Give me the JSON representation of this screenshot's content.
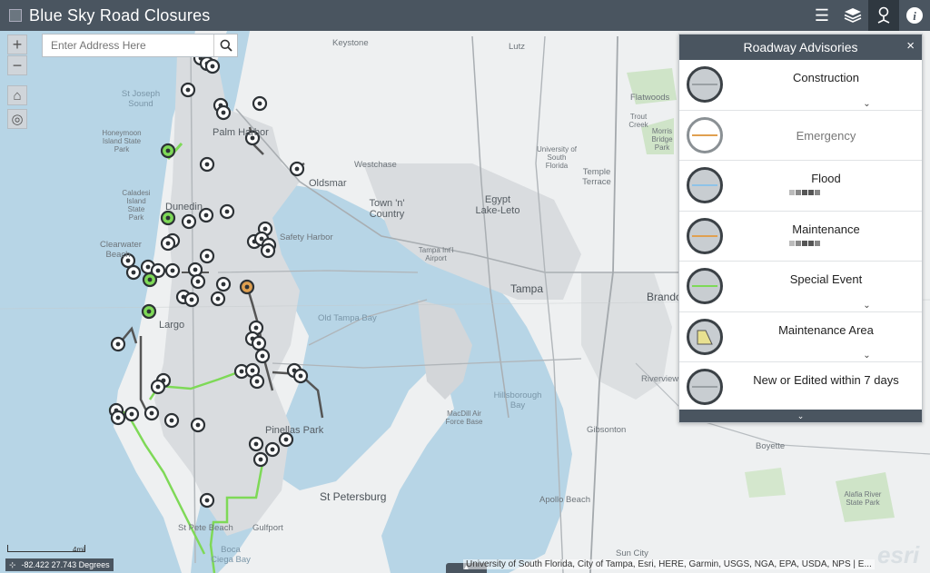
{
  "app": {
    "title": "Blue Sky Road Closures"
  },
  "header": {
    "tools": [
      {
        "icon": "list-icon",
        "symbol": "☰"
      },
      {
        "icon": "layers-icon",
        "symbol": "≋"
      },
      {
        "icon": "legend-icon",
        "symbol": "⚲"
      },
      {
        "icon": "info-icon",
        "symbol": "i"
      }
    ]
  },
  "map_controls": {
    "zoom_in": "+",
    "zoom_out": "−",
    "home": "⌂",
    "locate": "◎"
  },
  "search": {
    "placeholder": "Enter Address Here"
  },
  "panel": {
    "title": "Roadway Advisories",
    "close": "×",
    "items": [
      {
        "label": "Construction",
        "line_color": "#9aa0a4",
        "muted": false,
        "density": false
      },
      {
        "label": "Emergency",
        "line_color": "#e0a050",
        "muted": true,
        "density": false
      },
      {
        "label": "Flood",
        "line_color": "#8ec3e8",
        "muted": false,
        "density": true
      },
      {
        "label": "Maintenance",
        "line_color": "#e0a050",
        "muted": false,
        "density": true
      },
      {
        "label": "Special Event",
        "line_color": "#7ed957",
        "muted": false,
        "density": false
      },
      {
        "label": "Maintenance Area",
        "line_color": "#e8e090",
        "muted": false,
        "density": false
      },
      {
        "label": "New or Edited within 7 days",
        "line_color": "#9aa0a4",
        "muted": false,
        "density": false
      }
    ]
  },
  "map_labels": [
    "Keystone",
    "Lutz",
    "St Joseph Sound",
    "Honeymoon Island State Park",
    "Palm Harbor",
    "Caladesi Island State Park",
    "Dunedin",
    "Oldsmar",
    "Westchase",
    "Town 'n' Country",
    "Egypt Lake-Leto",
    "Clearwater Beach",
    "Safety Harbor",
    "Tampa Int'l Airport",
    "Tampa",
    "Brandon",
    "Largo",
    "Old Tampa Bay",
    "Pinellas Park",
    "Hillsborough Bay",
    "MacDill Air Force Base",
    "St Petersburg",
    "Gulfport",
    "St Pete Beach",
    "Boca Ciega Bay",
    "Apollo Beach",
    "Gibsonton",
    "Riverview",
    "Boyette",
    "Alafia River State Park",
    "Sun City",
    "University of South Florida",
    "Temple Terrace",
    "Flatwoods",
    "Trout Creek",
    "Morris Bridge Park"
  ],
  "footer": {
    "coordinates": "-82.422 27.743 Degrees",
    "attribution": "University of South Florida, City of Tampa, Esri, HERE, Garmin, USGS, NGA, EPA, USDA, NPS | E...",
    "scale": "4mi",
    "logo": "esri"
  },
  "colors": {
    "header": "#4a5560",
    "water": "#b7d5e6",
    "land": "#eef0f1",
    "urban": "#d6d9dc",
    "event": "#7ed957",
    "marker": "#2d3236"
  }
}
